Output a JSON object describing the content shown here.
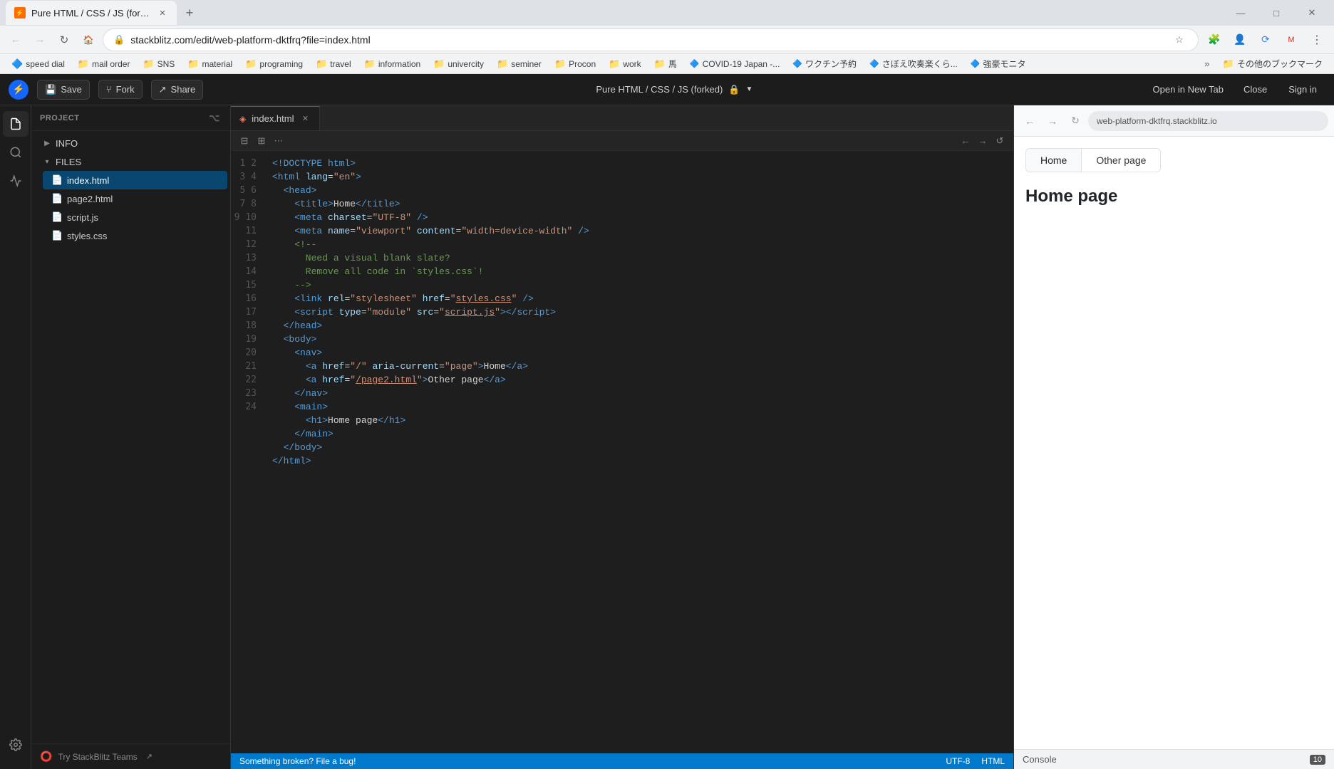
{
  "browser": {
    "tab_label": "Pure HTML / CSS / JS (forked",
    "tab_favicon_text": "⚡",
    "address_url": "stackblitz.com/edit/web-platform-dktfrq?file=index.html",
    "new_tab_label": "+",
    "window_minimize": "—",
    "window_maximize": "□",
    "window_close": "✕"
  },
  "bookmarks": [
    {
      "label": "speed dial",
      "icon": "🔷"
    },
    {
      "label": "mail order",
      "icon": "📁"
    },
    {
      "label": "SNS",
      "icon": "📁"
    },
    {
      "label": "material",
      "icon": "📁"
    },
    {
      "label": "programing",
      "icon": "📁"
    },
    {
      "label": "travel",
      "icon": "📁"
    },
    {
      "label": "information",
      "icon": "📁"
    },
    {
      "label": "univercity",
      "icon": "📁"
    },
    {
      "label": "seminer",
      "icon": "📁"
    },
    {
      "label": "Procon",
      "icon": "📁"
    },
    {
      "label": "work",
      "icon": "📁"
    },
    {
      "label": "馬",
      "icon": "📁"
    },
    {
      "label": "COVID-19 Japan -...",
      "icon": "🔷"
    },
    {
      "label": "ワクチン予約",
      "icon": "🔷"
    },
    {
      "label": "さぼえ吹奏楽くら...",
      "icon": "🔷"
    },
    {
      "label": "強豪モニタ",
      "icon": "🔷"
    }
  ],
  "stackblitz": {
    "project_label": "PROJECT",
    "info_label": "INFO",
    "files_label": "FILES",
    "save_label": "Save",
    "fork_label": "Fork",
    "share_label": "Share",
    "title": "Pure HTML / CSS / JS (forked)",
    "lock_icon": "🔒",
    "open_newtab_label": "Open in New Tab",
    "close_label": "Close",
    "signin_label": "Sign in",
    "preview_url": "web-platform-dktfrq.stackblitz.io",
    "editor_filename": "index.html",
    "try_teams_label": "Try StackBlitz Teams",
    "status_bar_text": "Something broken? File a bug!",
    "console_label": "Console",
    "console_badge": "10",
    "files": [
      {
        "name": "index.html",
        "icon": "📄",
        "active": true
      },
      {
        "name": "page2.html",
        "icon": "📄",
        "active": false
      },
      {
        "name": "script.js",
        "icon": "📄",
        "active": false
      },
      {
        "name": "styles.css",
        "icon": "📄",
        "active": false
      }
    ],
    "preview": {
      "nav_home_label": "Home",
      "nav_other_label": "Other page",
      "heading": "Home page"
    }
  },
  "code_lines": [
    "1",
    "2",
    "3",
    "4",
    "5",
    "6",
    "7",
    "8",
    "9",
    "10",
    "11",
    "12",
    "13",
    "14",
    "15",
    "16",
    "17",
    "18",
    "19",
    "20",
    "21",
    "22",
    "23",
    "24"
  ]
}
